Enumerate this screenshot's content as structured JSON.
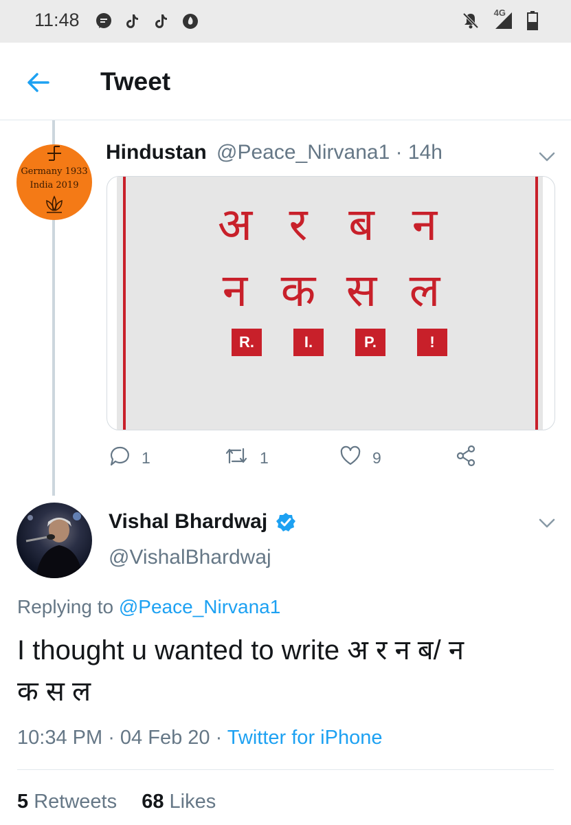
{
  "status_bar": {
    "time": "11:48",
    "network": "4G",
    "icons": [
      "message-icon",
      "tiktok-icon",
      "tiktok-icon",
      "fire-icon",
      "bell-off-icon",
      "signal-icon",
      "battery-icon"
    ]
  },
  "header": {
    "title": "Tweet"
  },
  "tweet1": {
    "author_name": "Hindustan",
    "handle_time": "@Peace_Nirvana1 · 14h",
    "avatar_line1": "Germany 1933",
    "avatar_line2": "India 2019",
    "media": {
      "row1": [
        "अ",
        "र",
        "ब",
        "न"
      ],
      "row2": [
        "न",
        "क",
        "स",
        "ल"
      ],
      "row3": [
        "R.",
        "I.",
        "P.",
        "!"
      ]
    },
    "replies": "1",
    "retweets": "1",
    "likes": "9"
  },
  "tweet2": {
    "author_name": "Vishal Bhardwaj",
    "handle": "@VishalBhardwaj",
    "replying_prefix": "Replying to",
    "replying_to": "@Peace_Nirvana1",
    "text_line1": "I thought u wanted to write अ र न ब/  न",
    "text_line2": "क स ल",
    "time": "10:34 PM",
    "date": "04 Feb 20",
    "source": "Twitter for iPhone",
    "retweets_count": "5",
    "retweets_label": "Retweets",
    "likes_count": "68",
    "likes_label": "Likes"
  },
  "colors": {
    "accent": "#1da1f2",
    "muted": "#657786",
    "media_red": "#c8202a",
    "avatar_orange": "#f47a16"
  }
}
